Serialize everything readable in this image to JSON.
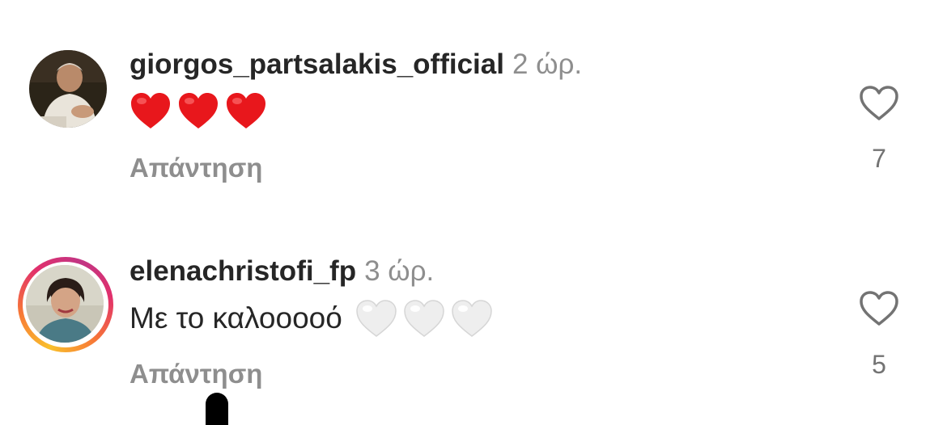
{
  "comments": [
    {
      "username": "giorgos_partsalakis_official",
      "time": "2 ώρ.",
      "text": "",
      "emoji_count": 3,
      "emoji": "red-heart",
      "reply_label": "Απάντηση",
      "likes": "7"
    },
    {
      "username": "elenachristofi_fp",
      "time": "3 ώρ.",
      "text": "Με το καλοοοοό",
      "emoji_count": 3,
      "emoji": "white-heart",
      "reply_label": "Απάντηση",
      "likes": "5",
      "has_story": true
    }
  ],
  "colors": {
    "username": "#262626",
    "timestamp": "#8e8e8e",
    "reply": "#8e8e8e",
    "red_heart": "#e8171c",
    "white_heart": "#eeeeee",
    "story_ring_start": "#f9c02c",
    "story_ring_end": "#c13584"
  }
}
